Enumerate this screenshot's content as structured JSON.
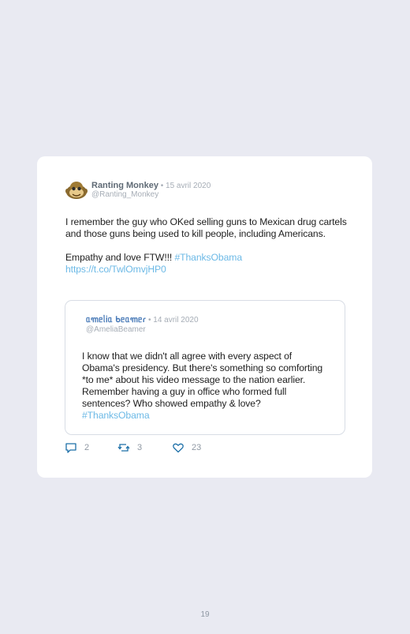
{
  "tweet": {
    "author_name": "Ranting Monkey",
    "separator": " • ",
    "date": "15 avril 2020",
    "handle": "@Ranting_Monkey",
    "paragraph1": "I remember the guy who OKed selling guns to Mexican drug cartels and those guns being used to kill people, including Americans.",
    "paragraph2_text": "Empathy and love FTW!!! ",
    "paragraph2_hashtag": "#ThanksObama",
    "link": "https://t.co/TwlOmvjHP0"
  },
  "quoted_tweet": {
    "author_name": "ᥲ꧑ᥱᥣᎥᥲ ᑲᥱᥲ꧑ᥱɾ",
    "separator": " • ",
    "date": "14 avril 2020",
    "handle": "@AmeliaBeamer",
    "text": "I know that we didn't all agree with every aspect of Obama's presidency. But there's something so comforting *to me* about his video message to the nation earlier. Remember having a guy in office who formed full sentences? Who showed empathy & love? ",
    "hashtag": "#ThanksObama"
  },
  "actions": {
    "replies": "2",
    "retweets": "3",
    "likes": "23",
    "reply_icon": "reply-icon",
    "retweet_icon": "retweet-icon",
    "like_icon": "heart-icon"
  },
  "page": {
    "number": "19"
  },
  "colors": {
    "background": "#e9eaf2",
    "card": "#ffffff",
    "hashtag": "#6cb9e6",
    "muted": "#a6adb6"
  }
}
